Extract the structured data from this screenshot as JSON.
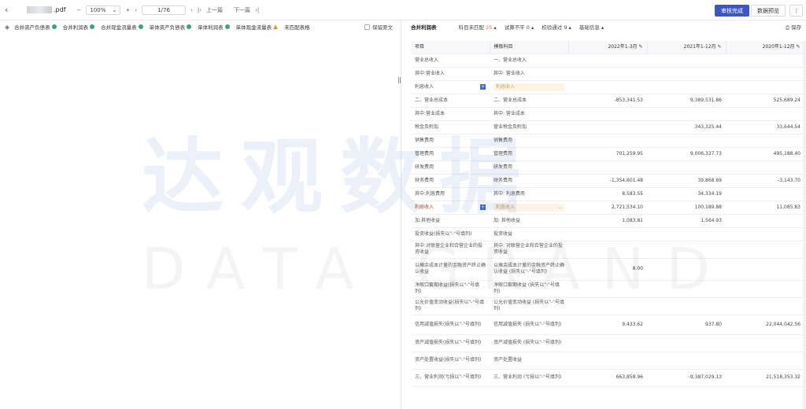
{
  "topbar": {
    "file_ext": ".pdf",
    "zoom": "100%",
    "page": "1/76",
    "prev_label": "上一篇",
    "next_label": "下一篇",
    "approve_label": "审核完成",
    "preview_label": "数据预览"
  },
  "left": {
    "tabs": [
      {
        "label": "合并资产负债表",
        "status": "ok"
      },
      {
        "label": "合并利润表",
        "status": "ok"
      },
      {
        "label": "合并现金流量表",
        "status": "ok"
      },
      {
        "label": "单体资产负债表",
        "status": "ok"
      },
      {
        "label": "单体利润表",
        "status": "ok"
      },
      {
        "label": "单体现金流量表",
        "status": "warn"
      },
      {
        "label": "未匹配表格",
        "status": "none"
      }
    ],
    "keep_label": "保留原文"
  },
  "watermark": {
    "cn": "达观数据",
    "en": "DATA GRAND"
  },
  "right": {
    "title": "合并利润表",
    "filters": [
      {
        "label": "科目未匹配",
        "num": "25"
      },
      {
        "label": "试算不平",
        "num": "0"
      },
      {
        "label": "校验通过",
        "num": "9"
      },
      {
        "label": "基础信息",
        "num": ""
      }
    ],
    "save_label": "保存",
    "headers": [
      "项目",
      "模板科目",
      "2022年1-3月",
      "2021年1-12月",
      "2020年1-12月"
    ],
    "rows": [
      {
        "item": "营业总收入",
        "tmpl": "一、营业总收入",
        "v1": "",
        "v2": "",
        "v3": ""
      },
      {
        "item": "其中:营业收入",
        "tmpl": "其中: 营业收入",
        "v1": "",
        "v2": "",
        "v3": ""
      },
      {
        "item": "利息收入",
        "tmpl": "利息收入",
        "v1": "",
        "v2": "",
        "v3": "",
        "pick": true
      },
      {
        "item": "二、营业总成本",
        "tmpl": "二、营业总成本",
        "v1": "-853,341.53",
        "v2": "9,389,531.86",
        "v3": "525,689.24"
      },
      {
        "item": "其中:营业成本",
        "tmpl": "其中: 营业成本",
        "v1": "",
        "v2": "",
        "v3": ""
      },
      {
        "item": "税金及附加",
        "tmpl": "营业税金及附加",
        "v1": "",
        "v2": "343,325.44",
        "v3": "33,644.54"
      },
      {
        "item": "销售费用",
        "tmpl": "销售费用",
        "v1": "",
        "v2": "",
        "v3": ""
      },
      {
        "item": "管理费用",
        "tmpl": "管理费用",
        "v1": "701,259.95",
        "v2": "9,006,337.73",
        "v3": "495,188.40"
      },
      {
        "item": "研发费用",
        "tmpl": "研发费用",
        "v1": "",
        "v2": "",
        "v3": ""
      },
      {
        "item": "财务费用",
        "tmpl": "财务费用",
        "v1": "-1,354,601.48",
        "v2": "39,868.69",
        "v3": "-3,143.70"
      },
      {
        "item": "其中:利息费用",
        "tmpl": "其中: 利息费用",
        "v1": "8,583.55",
        "v2": "34,334.19",
        "v3": ""
      },
      {
        "item": "利息收入",
        "tmpl": "利息收入",
        "v1": "2,721,534.10",
        "v2": "100,189.88",
        "v3": "11,085.83",
        "pick": true,
        "hl": true
      },
      {
        "item": "加:其他收益",
        "tmpl": "加: 其他收益",
        "v1": "1,083.81",
        "v2": "1,564.93",
        "v3": ""
      },
      {
        "item": "投资收益(损失以\"-\"号填列)",
        "tmpl": "投资收益",
        "v1": "",
        "v2": "",
        "v3": ""
      },
      {
        "item": "其中:对联营企业和合营企业的投资收益",
        "tmpl": "其中: 对联营企业和合营企业的投资收益",
        "v1": "",
        "v2": "",
        "v3": ""
      },
      {
        "item": "以摊余成本计量的金融资产终止确认收益",
        "tmpl": "以摊余成本计量的金融资产终止确认收益 (损失以\"-\"号填列)",
        "v1": "8.00",
        "v2": "",
        "v3": ""
      },
      {
        "item": "净敞口套期收益(损失以\"-\"号填列)",
        "tmpl": "净敞口套期收益 (损失以\"-\"号填列)",
        "v1": "",
        "v2": "",
        "v3": ""
      },
      {
        "item": "公允价值变动收益(损失以\"-\"号填列)",
        "tmpl": "公允价值变动收益 (损失以\"-\"号填列)",
        "v1": "",
        "v2": "",
        "v3": ""
      },
      {
        "item": "信用减值损失(损失以\"-\"号填列)",
        "tmpl": "信用减值损失 (损失以\"-\"号填列)",
        "v1": "9,433.62",
        "v2": "937.80",
        "v3": "22,044,042.56"
      },
      {
        "item": "资产减值损失(损失以\"-\"号填列)",
        "tmpl": "资产减值损失 (损失以\"-\"号填列)",
        "v1": "",
        "v2": "",
        "v3": ""
      },
      {
        "item": "资产处置收益(损失以\"-\"号填列)",
        "tmpl": "资产处置收益",
        "v1": "",
        "v2": "",
        "v3": ""
      },
      {
        "item": "三、营业利润(亏损以\"-\"号填列)",
        "tmpl": "三、营业利润 (亏损以\"-\"号填列)",
        "v1": "663,858.96",
        "v2": "-9,387,029.13",
        "v3": "21,518,353.32"
      }
    ]
  }
}
